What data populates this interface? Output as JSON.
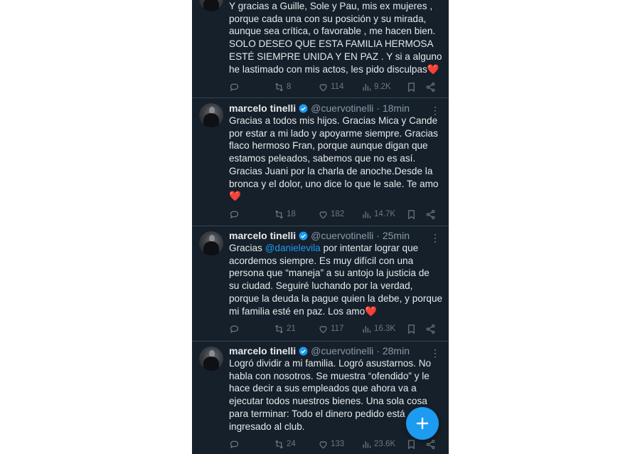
{
  "icons": {
    "reply": "reply-icon",
    "retweet": "retweet-icon",
    "like": "heart-icon",
    "views": "views-chart-icon",
    "bookmark": "bookmark-icon",
    "share": "share-icon",
    "verified": "verified-badge-icon",
    "more": "more-dots-icon",
    "compose": "compose-plus-icon"
  },
  "colors": {
    "background": "#15202b",
    "accent": "#1d9bf0",
    "text": "#e7e9ea",
    "muted": "#6e767d",
    "heart": "#f91880"
  },
  "more_glyph": "⋮",
  "tweets": [
    {
      "lines": [
        "Y gracias a Guille, Sole y Pau, mis ex mujeres ,",
        "porque cada una con su posición y su mirada,",
        "aunque sea crítica, o favorable , me hacen bien.",
        "SOLO DESEO QUE ESTA FAMILIA HERMOSA",
        "ESTÉ SIEMPRE UNIDA Y EN PAZ . Y si a alguno",
        "he lastimado con mis actos, les pido disculpas"
      ],
      "emoji": "❤️",
      "retweets": "8",
      "likes": "114",
      "views": "9.2K"
    },
    {
      "name": "marcelo tinelli",
      "handle": "@cuervotinelli",
      "time": "· 18min",
      "lines": [
        "Gracias a todos mis hijos. Gracias Mica y Cande",
        "por estar a mi lado y apoyarme siempre. Gracias",
        "flaco hermoso Fran, porque aunque digan que",
        "estamos peleados, sabemos que no es así.",
        "Gracias Juani por la charla de anoche.Desde la",
        "bronca y el dolor, uno dice lo que le sale. Te amo"
      ],
      "emoji": "❤️",
      "retweets": "18",
      "likes": "182",
      "views": "14.7K"
    },
    {
      "name": "marcelo tinelli",
      "handle": "@cuervotinelli",
      "time": "· 25min",
      "first_line_prefix": "Gracias ",
      "mention": "@danielevila",
      "first_line_suffix": " por intentar lograr que",
      "lines": [
        "acordemos siempre. Es muy difícil con una",
        "persona que “maneja” a su antojo la justicia de",
        "su ciudad. Seguiré luchando por la verdad,",
        "porque la deuda la pague quien la debe, y porque",
        "mi familia esté en paz. Los amo"
      ],
      "emoji": "❤️",
      "retweets": "21",
      "likes": "117",
      "views": "16.3K"
    },
    {
      "name": "marcelo tinelli",
      "handle": "@cuervotinelli",
      "time": "· 28min",
      "lines": [
        "Logró dividir a mi familia. Logró asustarnos. No",
        "habla con nosotros. Se muestra “ofendido” y le",
        "hace decir a sus empleados que ahora va a",
        "ejecutar todos nuestros bienes. Una sola cosa",
        "para terminar: Todo el dinero pedido está",
        "ingresado al club."
      ],
      "retweets": "24",
      "likes": "133",
      "views": "23.6K"
    }
  ]
}
